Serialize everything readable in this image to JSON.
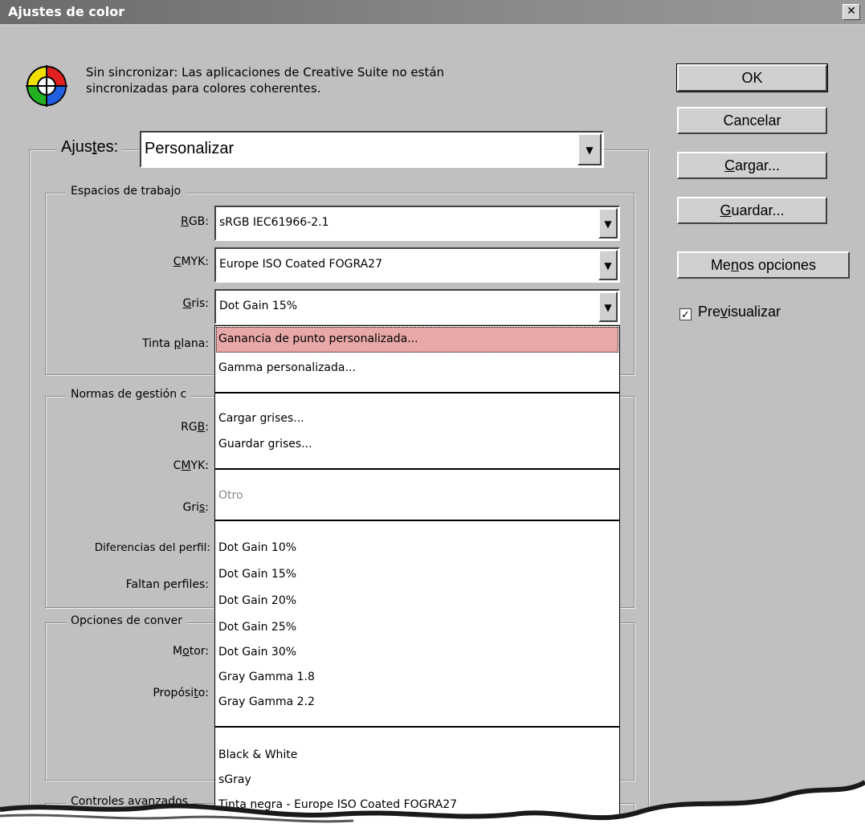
{
  "window": {
    "title": "Ajustes de color",
    "close_glyph": "✕"
  },
  "info": {
    "line1": "Sin sincronizar: Las aplicaciones de Creative Suite no están",
    "line2": "sincronizadas para colores coherentes."
  },
  "buttons": {
    "ok": "OK",
    "cancel": "Cancelar",
    "load_pre": "",
    "load_u": "C",
    "load_post": "argar...",
    "save_pre": "",
    "save_u": "G",
    "save_post": "uardar...",
    "less_pre": "Me",
    "less_u": "n",
    "less_post": "os opciones"
  },
  "preview": {
    "pre": "Pre",
    "u": "v",
    "post": "isualizar",
    "checked": true,
    "check_glyph": "✓"
  },
  "settings": {
    "label_pre": "Ajus",
    "label_u": "t",
    "label_post": "es:",
    "value": "Personalizar"
  },
  "workspaces": {
    "legend": "Espacios de trabajo",
    "rgb_label_u": "R",
    "rgb_label_post": "GB:",
    "rgb_value": "sRGB IEC61966-2.1",
    "cmyk_label_u": "C",
    "cmyk_label_post": "MYK:",
    "cmyk_value": "Europe ISO Coated FOGRA27",
    "gray_label_u": "G",
    "gray_label_post": "ris:",
    "gray_value": "Dot Gain 15%",
    "spot_label_pre": "Tinta ",
    "spot_label_u": "p",
    "spot_label_post": "lana:"
  },
  "policies": {
    "legend": "Normas de gestión c",
    "rgb_pre": "RG",
    "rgb_u": "B",
    "rgb_post": ":",
    "cmyk_pre": "C",
    "cmyk_u": "M",
    "cmyk_post": "YK:",
    "gray_pre": "Gri",
    "gray_u": "s",
    "gray_post": ":",
    "mismatch": "Diferencias del perfil:",
    "missing": "Faltan perfiles:"
  },
  "conversion": {
    "legend": "Opciones de conver",
    "engine_pre": "M",
    "engine_u": "o",
    "engine_post": "tor:",
    "intent_pre": "Propósi",
    "intent_u": "t",
    "intent_post": "o:"
  },
  "advanced": {
    "legend": "Controles avanzados"
  },
  "dropdown": {
    "items_top": [
      "Ganancia de punto personalizada...",
      "Gamma personalizada..."
    ],
    "items_file": [
      "Cargar grises...",
      "Guardar grises..."
    ],
    "other": "Otro",
    "items_gain": [
      "Dot Gain 10%",
      "Dot Gain 15%",
      "Dot Gain 20%",
      "Dot Gain 25%",
      "Dot Gain 30%",
      "Gray Gamma 1.8",
      "Gray Gamma 2.2"
    ],
    "items_profiles": [
      "Black & White",
      "sGray",
      "Tinta negra - Europe ISO Coated FOGRA27"
    ]
  },
  "icons": {
    "dropdown_arrow": "▼"
  },
  "colors": {
    "highlight": "#e8a8a8",
    "dialog_bg": "#c0c0c0"
  }
}
